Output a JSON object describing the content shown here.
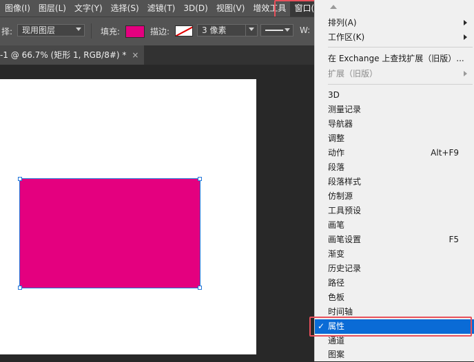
{
  "menubar": {
    "items": [
      "图像(I)",
      "图层(L)",
      "文字(Y)",
      "选择(S)",
      "滤镜(T)",
      "3D(D)",
      "视图(V)",
      "增效工具"
    ],
    "active": "窗口(W)"
  },
  "options": {
    "select_label": "择:",
    "select_value": "现用图层",
    "fill_label": "填充:",
    "fill_color": "#e4007f",
    "stroke_label": "描边:",
    "stroke_width_value": "3 像素",
    "w_label": "W:"
  },
  "document_tab": {
    "title": "-1 @ 66.7% (矩形 1, RGB/8#) *",
    "close": "×"
  },
  "shape": {
    "color": "#e4007f"
  },
  "window_menu": {
    "submenus": [
      {
        "label": "排列(A)"
      },
      {
        "label": "工作区(K)"
      }
    ],
    "exchange": {
      "label": "在 Exchange 上查找扩展（旧版）..."
    },
    "extensions": {
      "label": "扩展（旧版）"
    },
    "panels": [
      {
        "label": "3D",
        "shortcut": ""
      },
      {
        "label": "测量记录",
        "shortcut": ""
      },
      {
        "label": "导航器",
        "shortcut": ""
      },
      {
        "label": "调整",
        "shortcut": ""
      },
      {
        "label": "动作",
        "shortcut": "Alt+F9"
      },
      {
        "label": "段落",
        "shortcut": ""
      },
      {
        "label": "段落样式",
        "shortcut": ""
      },
      {
        "label": "仿制源",
        "shortcut": ""
      },
      {
        "label": "工具预设",
        "shortcut": ""
      },
      {
        "label": "画笔",
        "shortcut": ""
      },
      {
        "label": "画笔设置",
        "shortcut": "F5"
      },
      {
        "label": "渐变",
        "shortcut": ""
      },
      {
        "label": "历史记录",
        "shortcut": ""
      },
      {
        "label": "路径",
        "shortcut": ""
      },
      {
        "label": "色板",
        "shortcut": ""
      },
      {
        "label": "时间轴",
        "shortcut": ""
      },
      {
        "label": "属性",
        "shortcut": "",
        "checked": true
      },
      {
        "label": "通道",
        "shortcut": ""
      },
      {
        "label": "图案",
        "shortcut": ""
      }
    ],
    "check_mark": "✓"
  }
}
